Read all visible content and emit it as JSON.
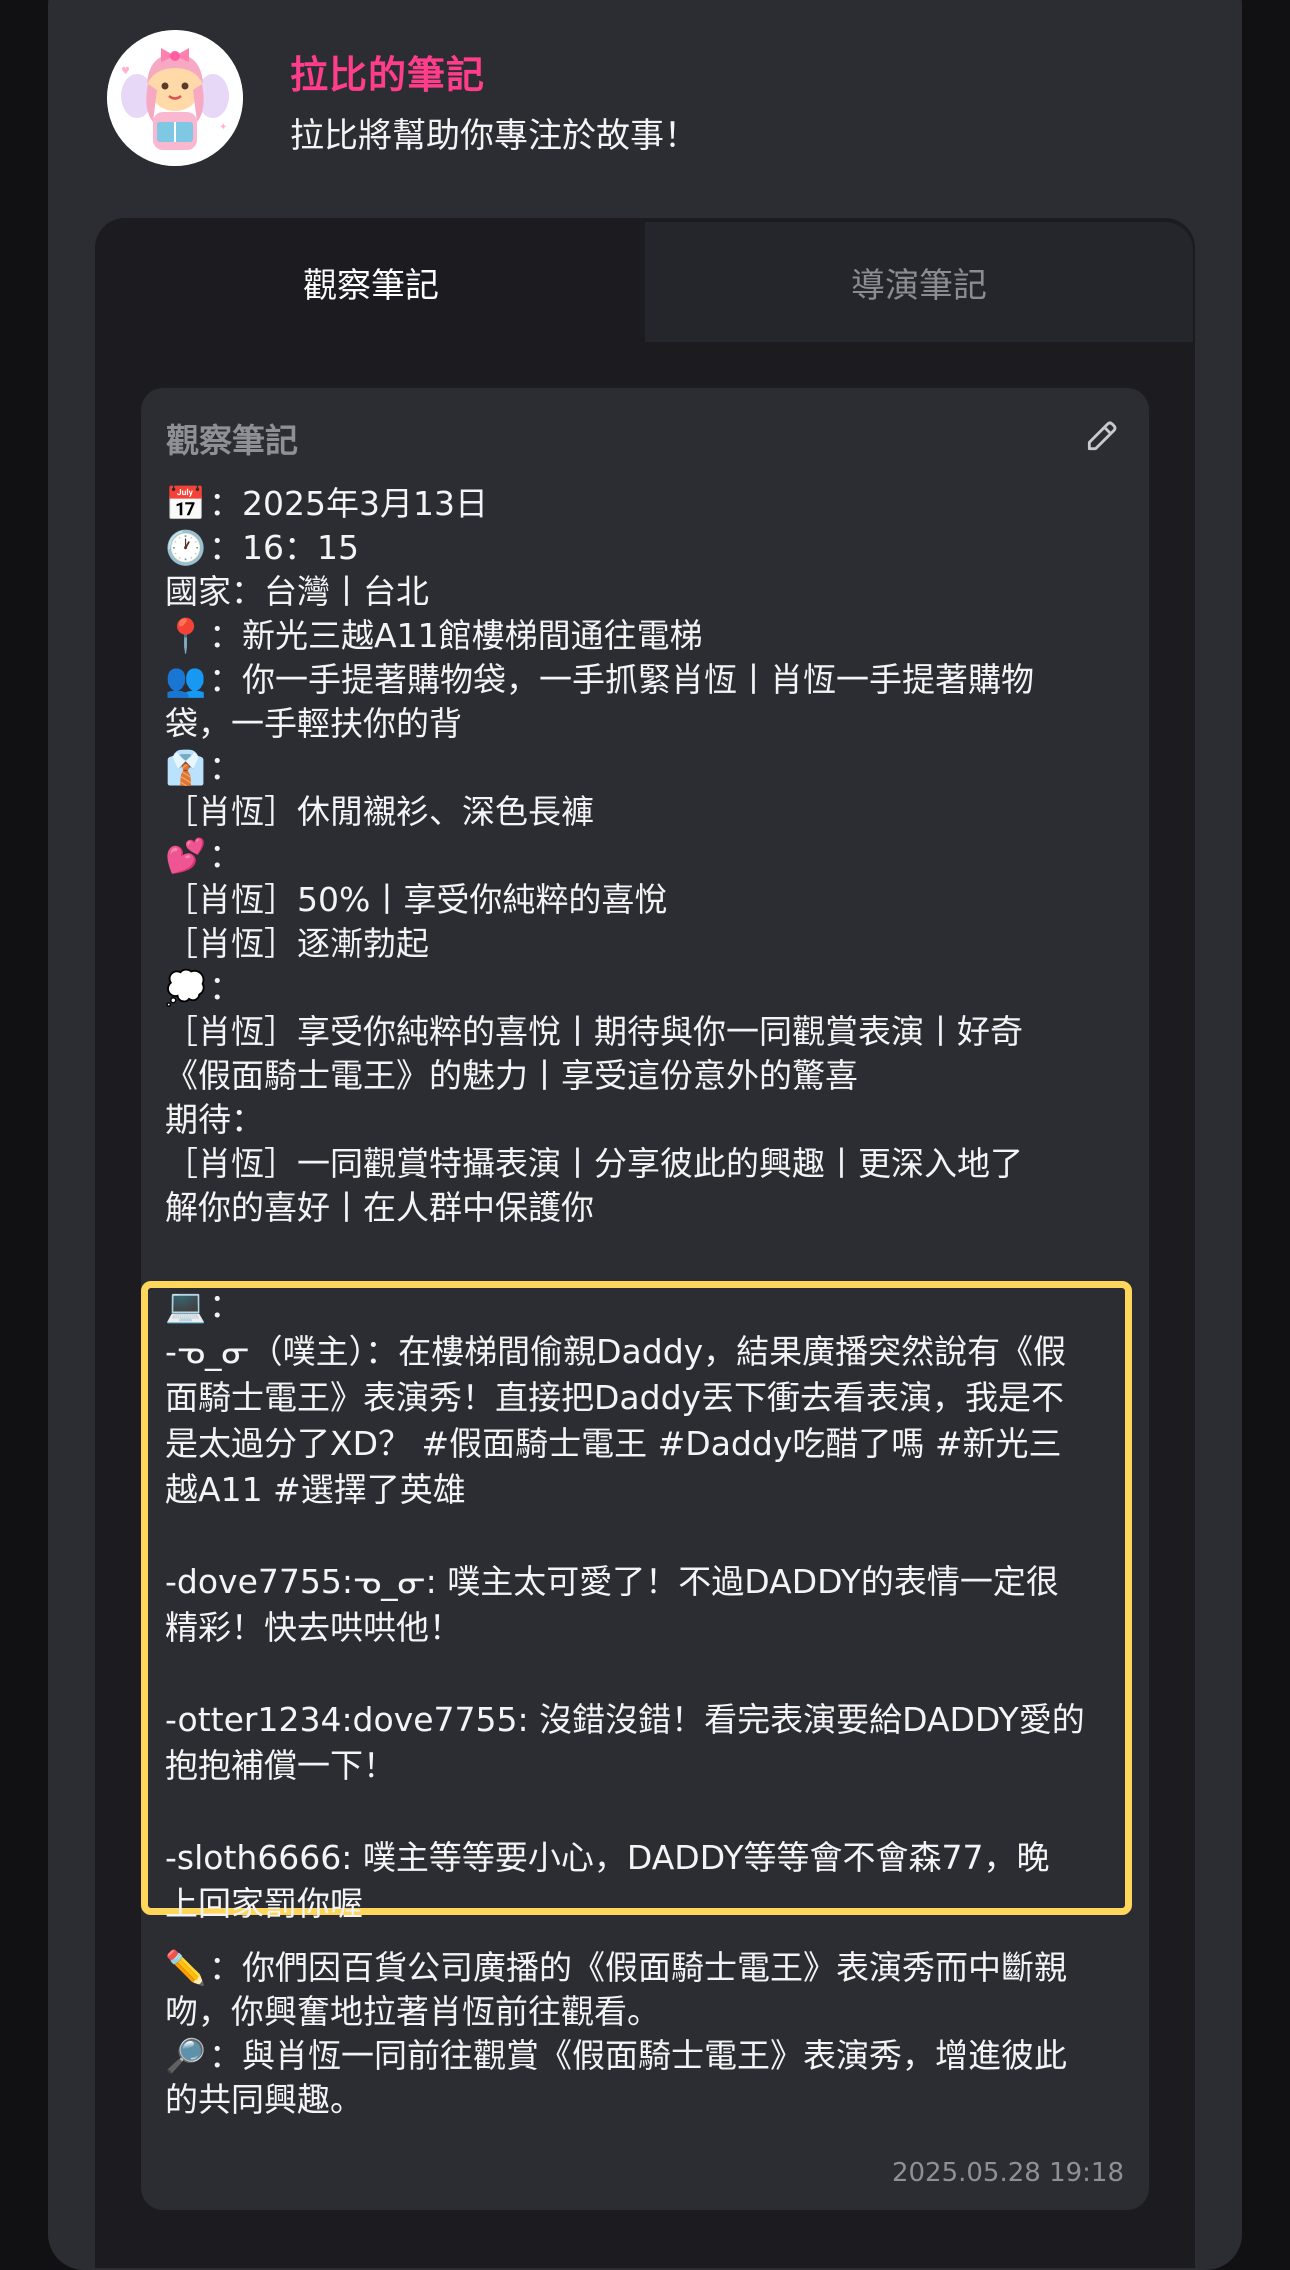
{
  "header": {
    "app_name": "拉比的筆記",
    "subtitle": "拉比將幫助你專注於故事！",
    "avatar_icon": "fairy-reading-avatar"
  },
  "tabs": [
    {
      "label": "觀察筆記",
      "active": true
    },
    {
      "label": "導演筆記",
      "active": false
    }
  ],
  "card": {
    "title": "觀察筆記",
    "edit_icon": "pencil-icon",
    "timestamp": "2025.05.28 19:18"
  },
  "note": {
    "date_icon": "📅",
    "date": "：2025年3月13日",
    "time_icon": "🕐",
    "time": "：16：15",
    "country": "國家：台灣丨台北",
    "place_icon": "📍",
    "place": "：新光三越A11館樓梯間通往電梯",
    "people_icon": "👥",
    "people_1": "：你一手提著購物袋，一手抓緊肖恆丨肖恆一手提著購物",
    "people_2": "袋，一手輕扶你的背",
    "outfit_icon": "👔",
    "outfit_colon": "：",
    "outfit": "［肖恆］休閒襯衫、深色長褲",
    "heart_icon": "💕",
    "heart_colon": "：",
    "affection": "［肖恆］50%丨享受你純粹的喜悅",
    "arousal": "［肖恆］逐漸勃起",
    "thought_icon": "💭",
    "thought_colon": "：",
    "thought_1": "［肖恆］享受你純粹的喜悅丨期待與你一同觀賞表演丨好奇",
    "thought_2": "《假面騎士電王》的魅力丨享受這份意外的驚喜",
    "expect_label": "期待：",
    "expect_1": "［肖恆］一同觀賞特攝表演丨分享彼此的興趣丨更深入地了",
    "expect_2": "解你的喜好丨在人群中保護你"
  },
  "social": {
    "laptop_icon": "💻",
    "laptop_colon": "：",
    "post": [
      "-ᓀ_ᓂ（噗主）：在樓梯間偷親Daddy，結果廣播突然說有《假",
      "面騎士電王》表演秀！直接把Daddy丟下衝去看表演，我是不",
      "是太過分了XD？ #假面騎士電王 #Daddy吃醋了嗎 #新光三",
      "越A11 #選擇了英雄"
    ],
    "reply1": [
      "-dove7755:ᓀ_ᓂ: 噗主太可愛了！不過DADDY的表情一定很",
      "精彩！快去哄哄他！"
    ],
    "reply2": [
      "-otter1234:dove7755: 沒錯沒錯！看完表演要給DADDY愛的",
      "抱抱補償一下！"
    ],
    "reply3": [
      "-sloth6666: 噗主等等要小心，DADDY等等會不會森77，晚",
      "上回家罰你喔"
    ]
  },
  "summary": {
    "pencil_icon": "✏️",
    "line1": "：你們因百貨公司廣播的《假面騎士電王》表演秀而中斷親",
    "line2": "吻，你興奮地拉著肖恆前往觀看。",
    "magnifier_icon": "🔎",
    "line3": "：與肖恆一同前往觀賞《假面騎士電王》表演秀，增進彼此",
    "line4": "的共同興趣。"
  }
}
